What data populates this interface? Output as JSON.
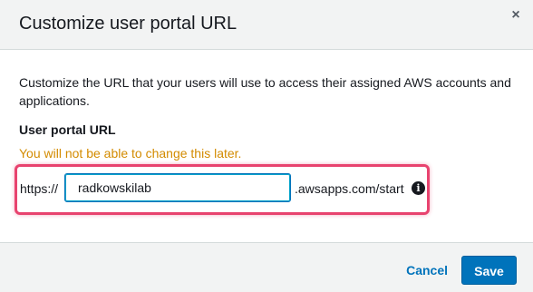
{
  "dialog": {
    "title": "Customize user portal URL",
    "close_glyph": "×"
  },
  "body": {
    "description": "Customize the URL that your users will use to access their assigned AWS accounts and applications.",
    "field_label": "User portal URL",
    "warning": "You will not be able to change this later.",
    "url_prefix": "https://",
    "url_value": "radkowskilab",
    "url_suffix": ".awsapps.com/start",
    "info_glyph": "i"
  },
  "footer": {
    "cancel_label": "Cancel",
    "save_label": "Save"
  },
  "colors": {
    "accent": "#0073bb",
    "warning": "#d38b00",
    "highlight": "#e8436f",
    "header_bg": "#f2f3f3"
  },
  "icons": {
    "close": "close-icon",
    "info": "info-icon"
  }
}
